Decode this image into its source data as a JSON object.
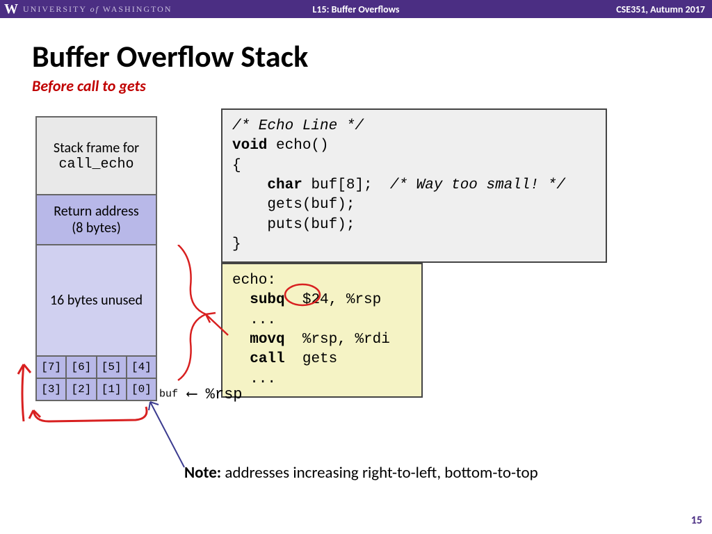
{
  "header": {
    "university_prefix": "UNIVERSITY",
    "university_of": "of",
    "university_suffix": "WASHINGTON",
    "w": "W",
    "lecture": "L15:  Buffer Overflows",
    "course": "CSE351, Autumn 2017"
  },
  "title": "Buffer Overflow Stack",
  "subtitle": "Before call to gets",
  "stack": {
    "frame_line1": "Stack frame for",
    "frame_line2": "call_echo",
    "ret_line1": "Return address",
    "ret_line2": "(8 bytes)",
    "unused": "16 bytes unused",
    "row1": [
      "[7]",
      "[6]",
      "[5]",
      "[4]"
    ],
    "row2": [
      "[3]",
      "[2]",
      "[1]",
      "[0]"
    ]
  },
  "code_c": {
    "l1": "/* Echo Line */",
    "l2a": "void",
    "l2b": " echo()",
    "l3": "{",
    "l4a": "    ",
    "l4b": "char",
    "l4c": " buf[8];  ",
    "l4d": "/* Way too small! */",
    "l5": "    gets(buf);",
    "l6": "    puts(buf);",
    "l7": "}"
  },
  "code_asm": {
    "l1": "echo:",
    "l2a": "  ",
    "l2b": "subq",
    "l2c": "  $24, %rsp",
    "l3": "  ...",
    "l4a": "  ",
    "l4b": "movq",
    "l4c": "  %rsp, %rdi",
    "l5a": "  ",
    "l5b": "call",
    "l5c": "  gets",
    "l6": "  ..."
  },
  "rsp": {
    "buf": "buf",
    "arrow": "⟵",
    "reg": "%rsp"
  },
  "note": {
    "label": "Note:",
    "text": " addresses increasing right-to-left, bottom-to-top"
  },
  "page": "15"
}
